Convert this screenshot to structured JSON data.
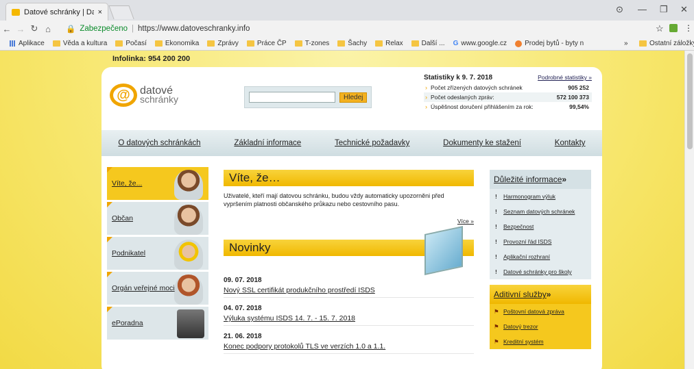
{
  "tab": {
    "title": "Datové schránky | Datov",
    "close": "×"
  },
  "window": {
    "account_icon": "⊙",
    "minimize": "—",
    "restore": "❐",
    "close": "✕"
  },
  "address": {
    "secure_label": "Zabezpečeno",
    "url": "https://www.datoveschranky.info"
  },
  "bookmarks": [
    "Aplikace",
    "Věda a kultura",
    "Počasí",
    "Ekonomika",
    "Zprávy",
    "Práce ČP",
    "T-zones",
    "Šachy",
    "Relax",
    "Další ...",
    "www.google.cz",
    "Prodej bytů - byty n"
  ],
  "bookmarks_more": "»",
  "bookmarks_other": "Ostatní záložky",
  "infolinka": "Infolinka: 954 200 200",
  "logo": {
    "line1": "datové",
    "line2": "schránky"
  },
  "search": {
    "button": "Hledej",
    "value": ""
  },
  "stats": {
    "title": "Statistiky k 9. 7. 2018",
    "detail_link": "Podrobné statistiky »",
    "rows": [
      {
        "label": "Počet zřízených datových schránek",
        "value": "905 252"
      },
      {
        "label": "Počet odeslaných zpráv:",
        "value": "572 100 373"
      },
      {
        "label": "Úspěšnost doručení přihlášením za rok:",
        "value": "99,54%"
      }
    ]
  },
  "nav": [
    "O datových schránkách",
    "Základní informace",
    "Technické požadavky",
    "Dokumenty ke stažení",
    "Kontakty"
  ],
  "sidebar": [
    "Víte, že...",
    "Občan",
    "Podnikatel",
    "Orgán veřejné moci",
    "ePoradna"
  ],
  "vite": {
    "heading": "Víte, že…",
    "text": "Uživatelé, kteří mají datovou schránku, budou vždy automaticky upozorněni před vypršením platnosti občanského průkazu nebo cestovního pasu.",
    "more": "Více »"
  },
  "novinky": {
    "heading": "Novinky"
  },
  "news": [
    {
      "date": "09. 07. 2018",
      "title": "Nový SSL certifikát produkčního prostředí ISDS"
    },
    {
      "date": "04. 07. 2018",
      "title": "Výluka systému ISDS 14. 7. - 15. 7. 2018"
    },
    {
      "date": "21. 06. 2018",
      "title": "Konec podpory protokolů TLS ve verzích 1.0 a 1.1."
    }
  ],
  "important": {
    "heading": "Důležité informace",
    "arrow": " »",
    "items": [
      "Harmonogram výluk",
      "Seznam datových schránek",
      "Bezpečnost",
      "Provozní řád ISDS",
      "Aplikační rozhraní",
      "Datové schránky pro školy"
    ]
  },
  "addons": {
    "heading": "Aditivní služby",
    "arrow": " »",
    "items": [
      "Poštovní datová zpráva",
      "Datový trezor",
      "Kreditní systém"
    ]
  }
}
